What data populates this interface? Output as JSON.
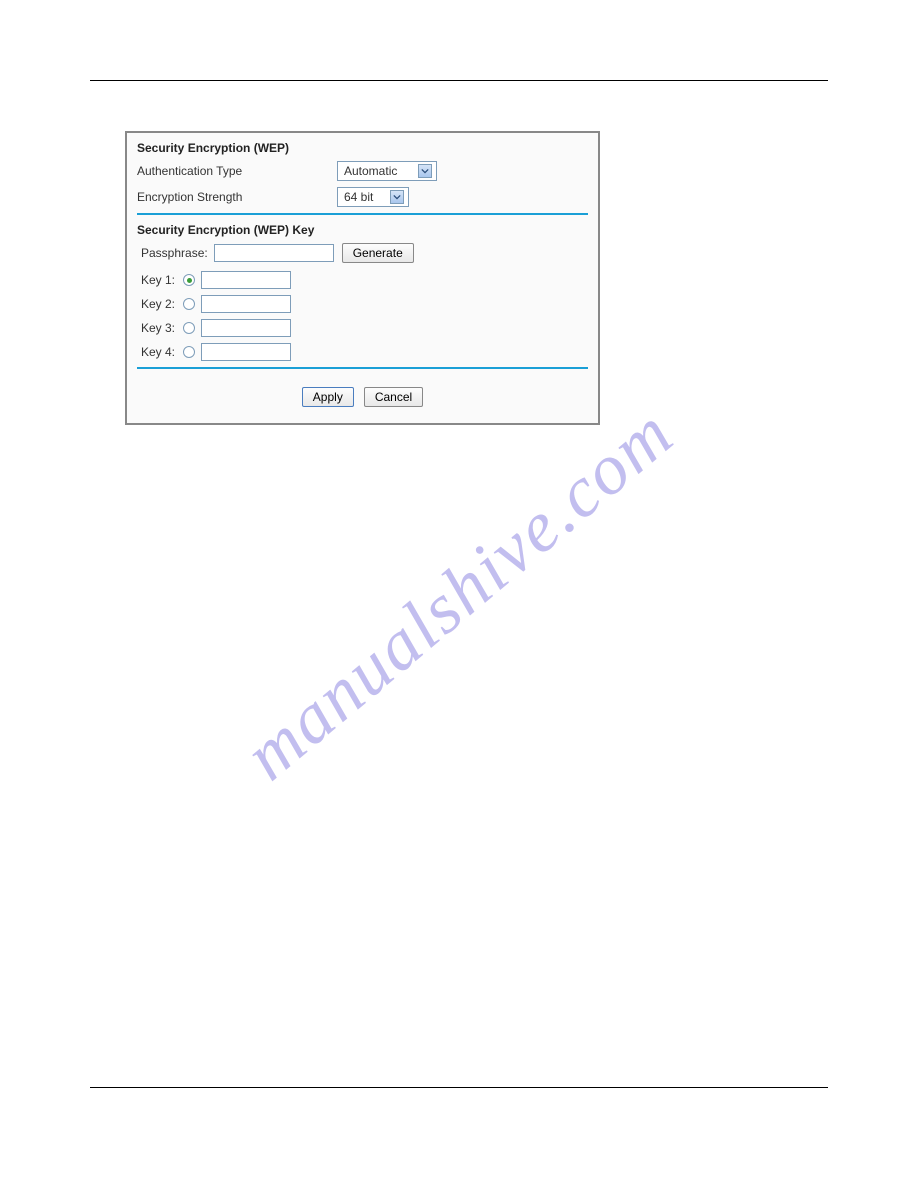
{
  "watermark": "manualshive.com",
  "panel": {
    "section1_heading": "Security Encryption (WEP)",
    "auth_type_label": "Authentication Type",
    "auth_type_value": "Automatic",
    "enc_strength_label": "Encryption Strength",
    "enc_strength_value": "64 bit",
    "section2_heading": "Security Encryption (WEP) Key",
    "passphrase_label": "Passphrase:",
    "passphrase_value": "",
    "generate_label": "Generate",
    "keys": [
      {
        "label": "Key 1:",
        "selected": true,
        "value": ""
      },
      {
        "label": "Key 2:",
        "selected": false,
        "value": ""
      },
      {
        "label": "Key 3:",
        "selected": false,
        "value": ""
      },
      {
        "label": "Key 4:",
        "selected": false,
        "value": ""
      }
    ],
    "apply_label": "Apply",
    "cancel_label": "Cancel"
  }
}
